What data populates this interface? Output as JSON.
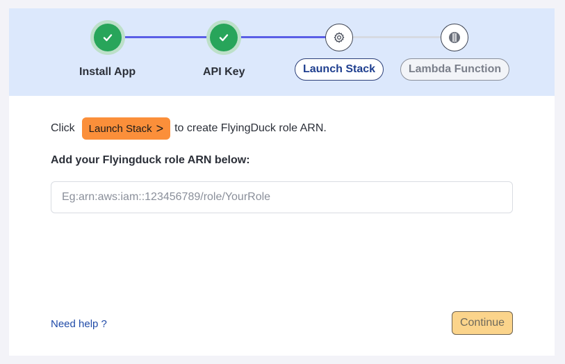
{
  "steps": [
    {
      "label": "Install App",
      "status": "done",
      "icon": "check-icon"
    },
    {
      "label": "API Key",
      "status": "done",
      "icon": "check-icon"
    },
    {
      "label": "Launch Stack",
      "status": "active",
      "icon": "gear-icon"
    },
    {
      "label": "Lambda Function",
      "status": "pending",
      "icon": "lambda-icon"
    }
  ],
  "instruction": {
    "prefix": "Click",
    "button_label": "Launch Stack",
    "button_arrow": ">",
    "suffix": "to create FlyingDuck role ARN."
  },
  "form": {
    "label": "Add your Flyingduck role ARN below:",
    "arn_value": "",
    "arn_placeholder": "Eg:arn:aws:iam::123456789/role/YourRole"
  },
  "footer": {
    "help_label": "Need help ?",
    "continue_label": "Continue"
  },
  "colors": {
    "stepper_bg": "#dce8fc",
    "progress_line": "#5a5ee6",
    "done_green": "#28a55a",
    "launch_orange": "#fb8f3a",
    "continue_bg": "#fbd48b",
    "link_blue": "#1f4aa8"
  }
}
